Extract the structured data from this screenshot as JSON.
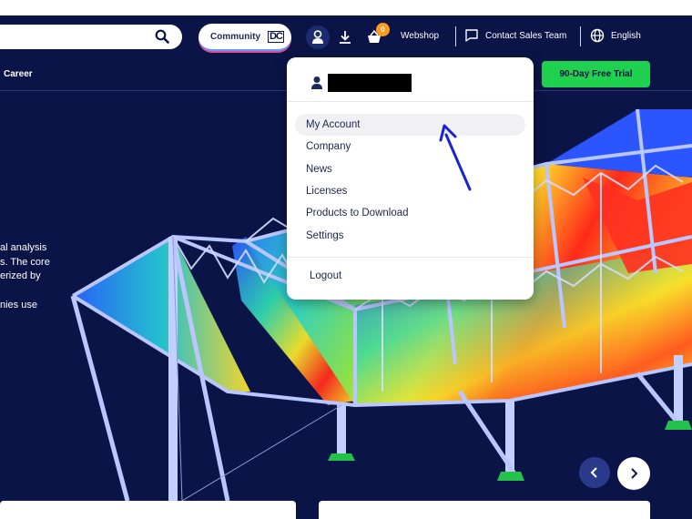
{
  "header": {
    "community_label": "Community",
    "community_logo": "DC",
    "cart_count": "0",
    "webshop_label": "Webshop",
    "contact_label": "Contact Sales Team",
    "language_label": "English"
  },
  "subnav": {
    "career_label": "Career",
    "trial_label": "90-Day Free Trial"
  },
  "hero": {
    "lines": [
      "al analysis",
      "s. The core",
      "erized by",
      "nies use"
    ]
  },
  "user_menu": {
    "username": "",
    "items": [
      {
        "label": "My Account"
      },
      {
        "label": "Company"
      },
      {
        "label": "News"
      },
      {
        "label": "Licenses"
      },
      {
        "label": "Products to Download"
      },
      {
        "label": "Settings"
      }
    ],
    "logout_label": "Logout"
  },
  "colors": {
    "background": "#0b1447",
    "accent_green": "#1fd14e",
    "badge_orange": "#ff9a1f",
    "structure_blue": "#aab8ff",
    "annotation_arrow": "#1b22d6"
  },
  "icons": [
    "search-icon",
    "user-icon",
    "download-icon",
    "cart-icon",
    "chat-icon",
    "globe-icon",
    "chevron-left-icon",
    "chevron-right-icon"
  ]
}
